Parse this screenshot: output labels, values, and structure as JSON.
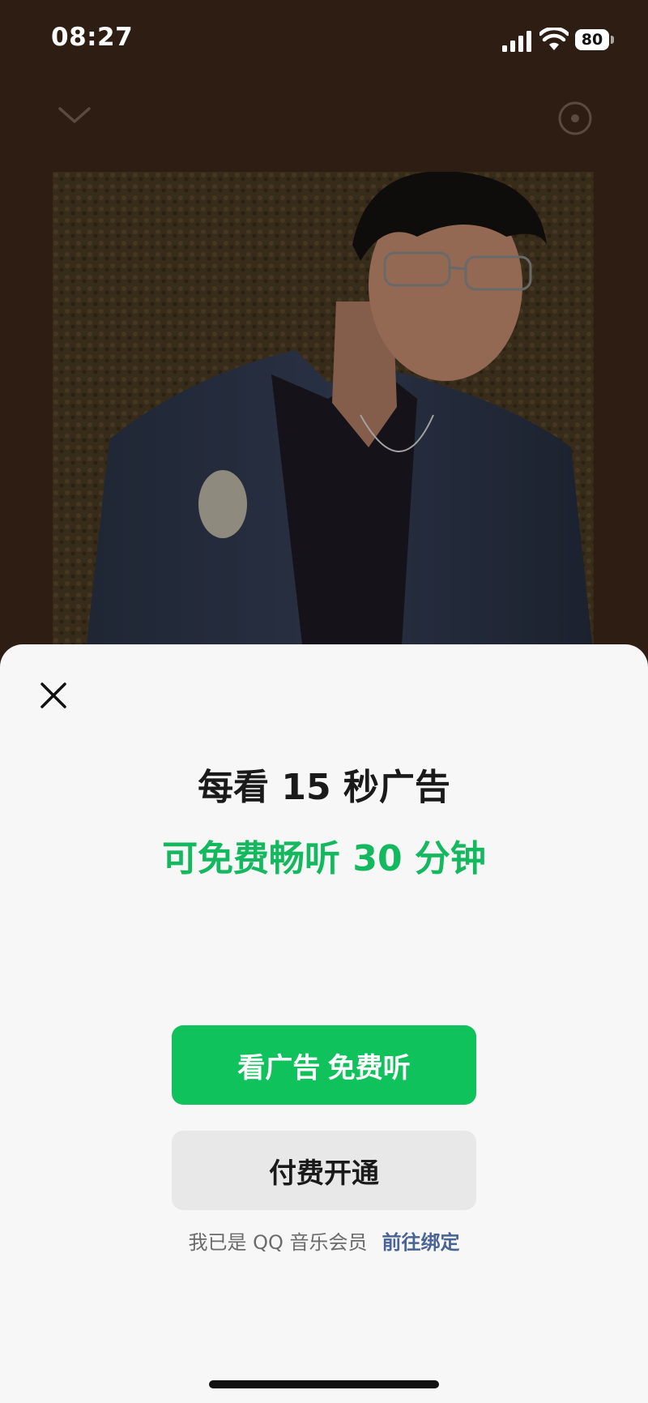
{
  "status_bar": {
    "time": "08:27",
    "battery": "80",
    "icons": [
      "signal-icon",
      "wifi-icon",
      "battery-icon"
    ]
  },
  "player": {
    "icons": [
      "chevron-down-icon",
      "record-icon"
    ],
    "album_art": "artist-photo"
  },
  "sheet": {
    "title": "每看 15 秒广告",
    "subtitle": "可免费畅听 30 分钟",
    "watch_ad_button": "看广告 免费听",
    "pay_button": "付费开通",
    "member_text": "我已是 QQ 音乐会员",
    "member_link": "前往绑定",
    "colors": {
      "accent_green": "#10c25b",
      "subtitle_green": "#14b85e",
      "link_blue": "#4a6395",
      "sheet_bg": "#f7f7f7",
      "backdrop": "#2e1d12"
    }
  }
}
